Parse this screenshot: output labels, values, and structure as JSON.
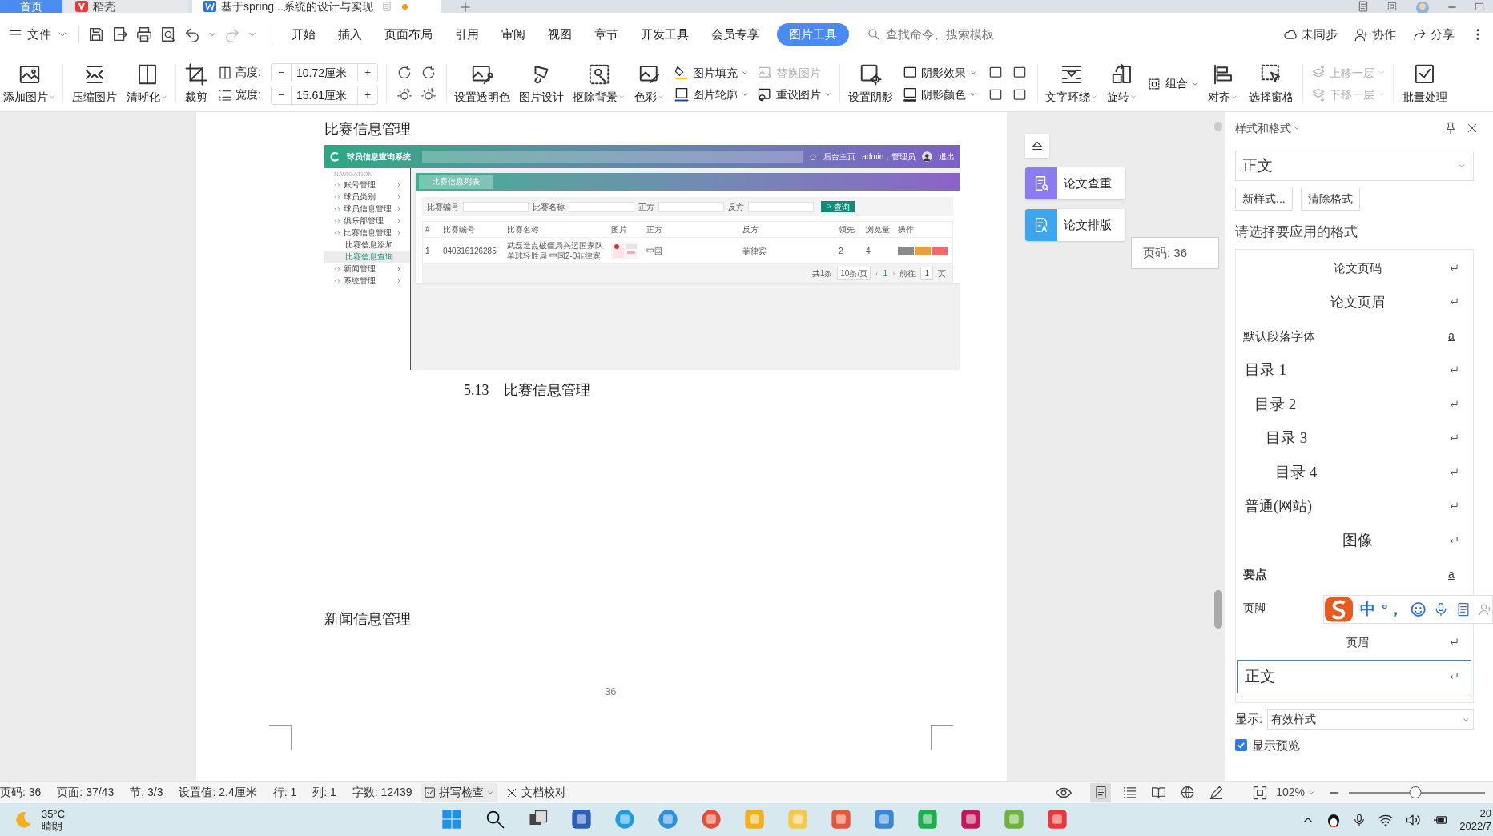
{
  "tabs": [
    {
      "label": "首页",
      "kind": "home",
      "selected": false,
      "unsaved": false
    },
    {
      "label": "稻壳",
      "kind": "app",
      "selected": false,
      "unsaved": false
    },
    {
      "label": "基于spring...系统的设计与实现",
      "kind": "doc",
      "selected": true,
      "unsaved": true
    }
  ],
  "menu": {
    "file": "文件",
    "tabs": [
      {
        "label": "开始",
        "selected": false
      },
      {
        "label": "插入",
        "selected": false
      },
      {
        "label": "页面布局",
        "selected": false
      },
      {
        "label": "引用",
        "selected": false
      },
      {
        "label": "审阅",
        "selected": false
      },
      {
        "label": "视图",
        "selected": false
      },
      {
        "label": "章节",
        "selected": false
      },
      {
        "label": "开发工具",
        "selected": false
      },
      {
        "label": "会员专享",
        "selected": false
      },
      {
        "label": "图片工具",
        "selected": true
      }
    ],
    "search_placeholder": "查找命令、搜索模板",
    "actions": [
      "未同步",
      "协作",
      "分享"
    ]
  },
  "ribbon": [
    {
      "kind": "large",
      "label": "添加图片",
      "caret": true
    },
    {
      "kind": "large",
      "label": "压缩图片",
      "caret": false
    },
    {
      "kind": "large",
      "label": "清晰化",
      "caret": true
    },
    {
      "kind": "large",
      "label": "裁剪",
      "caret": false
    },
    {
      "kind": "size",
      "rows": [
        {
          "label": "高度:",
          "minus": "−",
          "value": "10.72厘米",
          "plus": "+"
        },
        {
          "label": "宽度:",
          "minus": "−",
          "value": "15.61厘米",
          "plus": "+"
        }
      ]
    },
    {
      "kind": "icons"
    },
    {
      "kind": "large",
      "label": "设置透明色",
      "caret": false
    },
    {
      "kind": "large",
      "label": "图片设计",
      "caret": false
    },
    {
      "kind": "large",
      "label": "抠除背景",
      "caret": true
    },
    {
      "kind": "large",
      "label": "色彩",
      "caret": true
    },
    {
      "kind": "pair",
      "items": [
        {
          "label": "图片填充",
          "caret": true,
          "disabled": false
        },
        {
          "label": "图片轮廓",
          "caret": true,
          "disabled": false
        }
      ]
    },
    {
      "kind": "pair",
      "items": [
        {
          "label": "替换图片",
          "caret": false,
          "disabled": true
        },
        {
          "label": "重设图片",
          "caret": true,
          "disabled": false
        }
      ]
    },
    {
      "kind": "large",
      "label": "设置阴影",
      "caret": false
    },
    {
      "kind": "pair",
      "items": [
        {
          "label": "阴影效果",
          "caret": true,
          "disabled": false
        },
        {
          "label": "阴影颜色",
          "caret": true,
          "disabled": false
        }
      ]
    },
    {
      "kind": "icons"
    },
    {
      "kind": "large",
      "label": "文字环绕",
      "caret": true
    },
    {
      "kind": "large",
      "label": "旋转",
      "caret": true
    },
    {
      "kind": "pair",
      "items": [
        {
          "label": "组合",
          "caret": true,
          "disabled": false
        }
      ]
    },
    {
      "kind": "large",
      "label": "对齐",
      "caret": true
    },
    {
      "kind": "large",
      "label": "选择窗格",
      "caret": false
    },
    {
      "kind": "pair",
      "items": [
        {
          "label": "上移一层",
          "caret": true,
          "disabled": true
        },
        {
          "label": "下移一层",
          "caret": true,
          "disabled": true
        }
      ]
    },
    {
      "kind": "large",
      "label": "批量处理",
      "caret": false
    }
  ],
  "document": {
    "heading": "比赛信息管理",
    "figure": {
      "app_title": "球员信息查询系统",
      "header_links": [
        "后台主页",
        "admin，管理员",
        "退出"
      ],
      "nav_label": "NAVIGATION",
      "nav": [
        {
          "label": "账号管理",
          "selected": false
        },
        {
          "label": "球员类别",
          "selected": false
        },
        {
          "label": "球员信息管理",
          "selected": false
        },
        {
          "label": "俱乐部管理",
          "selected": false
        },
        {
          "label": "比赛信息管理",
          "selected": false,
          "children": [
            {
              "label": "比赛信息添加",
              "selected": false
            },
            {
              "label": "比赛信息查询",
              "selected": true
            }
          ]
        },
        {
          "label": "新闻管理",
          "selected": false
        },
        {
          "label": "系统管理",
          "selected": false
        }
      ],
      "panel_tab": "比赛信息列表",
      "filters": [
        "比赛编号",
        "比赛名称",
        "正方",
        "反方"
      ],
      "search_button": "查询",
      "columns": [
        "#",
        "比赛编号",
        "比赛名称",
        "图片",
        "正方",
        "反方",
        "领先",
        "浏览量",
        "操作"
      ],
      "rows": [
        {
          "cells": [
            "1",
            "040316126285",
            "武磊造点破僵局兴运国家队单球轻胜局 中国2-0菲律宾",
            "",
            "中国",
            "菲律宾",
            "2",
            "4"
          ]
        }
      ],
      "pagination": {
        "total": "共1条",
        "page_size": "10条/页",
        "prev": "‹",
        "page": "1",
        "next": "›",
        "goto": "前往",
        "goto_value": "1",
        "unit": "页"
      }
    },
    "caption": "5.13　比赛信息管理",
    "heading_2": "新闻信息管理",
    "page_number": "36"
  },
  "side_tools": [
    {
      "label": "论文查重",
      "color": "#8b7cf2"
    },
    {
      "label": "论文排版",
      "color": "#3ca7ee"
    }
  ],
  "tooltip": "页码: 36",
  "styles_panel": {
    "title": "样式和格式",
    "current_style": "正文",
    "buttons": [
      "新样式...",
      "清除格式"
    ],
    "prompt": "请选择要应用的格式",
    "styles": [
      {
        "label": "论文页码",
        "kind": "paragraph",
        "bold": false,
        "selected": false
      },
      {
        "label": "论文页眉",
        "kind": "paragraph",
        "bold": false,
        "selected": false
      },
      {
        "label": "默认段落字体",
        "kind": "character",
        "marker": "a",
        "bold": false,
        "selected": false
      },
      {
        "label": "目录 1",
        "kind": "paragraph",
        "bold": false,
        "selected": false
      },
      {
        "label": "目录 2",
        "kind": "paragraph",
        "bold": false,
        "selected": false
      },
      {
        "label": "目录 3",
        "kind": "paragraph",
        "bold": false,
        "selected": false
      },
      {
        "label": "目录 4",
        "kind": "paragraph",
        "bold": false,
        "selected": false
      },
      {
        "label": "普通(网站)",
        "kind": "paragraph",
        "bold": false,
        "selected": false
      },
      {
        "label": "图像",
        "kind": "paragraph",
        "bold": false,
        "selected": false
      },
      {
        "label": "要点",
        "kind": "character",
        "marker": "a",
        "bold": true,
        "selected": false
      },
      {
        "label": "页脚",
        "kind": "paragraph",
        "bold": false,
        "selected": false
      },
      {
        "label": "页眉",
        "kind": "paragraph",
        "bold": false,
        "selected": false
      },
      {
        "label": "正文",
        "kind": "paragraph",
        "bold": false,
        "selected": true
      }
    ],
    "show_label": "显示:",
    "show_value": "有效样式",
    "preview": {
      "label": "显示预览",
      "checked": true
    }
  },
  "ime": {
    "items": [
      "中",
      "°，"
    ]
  },
  "status_bar": {
    "items": [
      "页码: 36",
      "页面: 37/43",
      "节: 3/3",
      "设置值: 2.4厘米",
      "行: 1",
      "列: 1",
      "字数: 12439"
    ],
    "spell_check": "拼写检查",
    "proofread": "文档校对",
    "views": [
      {
        "selected": true
      },
      {
        "selected": false
      },
      {
        "selected": false
      },
      {
        "selected": false
      },
      {
        "selected": false
      }
    ],
    "zoom": "102%",
    "zoom_slider": {
      "level": 0.49
    }
  },
  "taskbar": {
    "temperature": "35°C",
    "weather": "晴朗",
    "clock": [
      "20",
      "2022/7"
    ]
  }
}
